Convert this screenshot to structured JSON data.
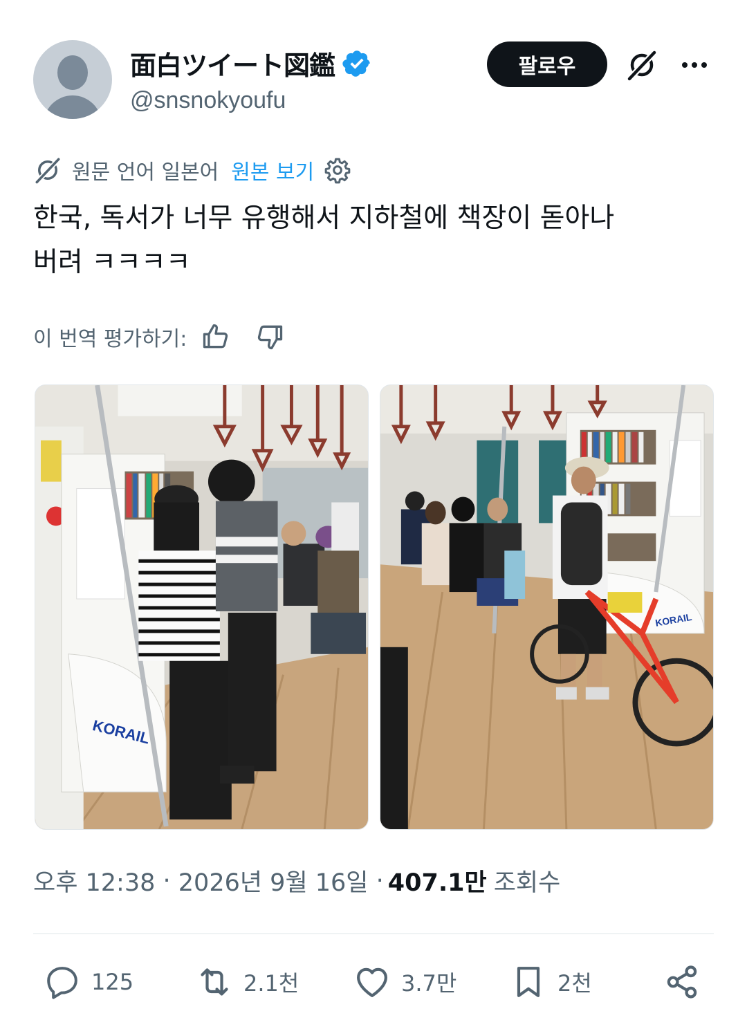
{
  "author": {
    "display_name": "面白ツイート図鑑",
    "handle": "@snsnokyoufu",
    "verified_icon": "verified-badge-icon"
  },
  "header": {
    "follow_label": "팔로우"
  },
  "translation": {
    "lang_label": "원문 언어 일본어",
    "show_original_label": "원본 보기"
  },
  "tweet": {
    "text": "한국, 독서가 너무 유행해서 지하철에 책장이 돋아나\n버려 ㅋㅋㅋㅋ"
  },
  "rate": {
    "label": "이 번역 평가하기:"
  },
  "meta": {
    "time": "오후 12:38",
    "date": "2026년 9월 16일",
    "views": "407.1만",
    "views_label": "조회수"
  },
  "actions": {
    "replies": "125",
    "reposts": "2.1천",
    "likes": "3.7만",
    "bookmarks": "2천"
  },
  "media": {
    "photo1_logo": "KORAIL",
    "photo2_logo": "KORAIL"
  },
  "colors": {
    "accent": "#1d9bf0",
    "text": "#0f1419",
    "muted": "#536471"
  }
}
